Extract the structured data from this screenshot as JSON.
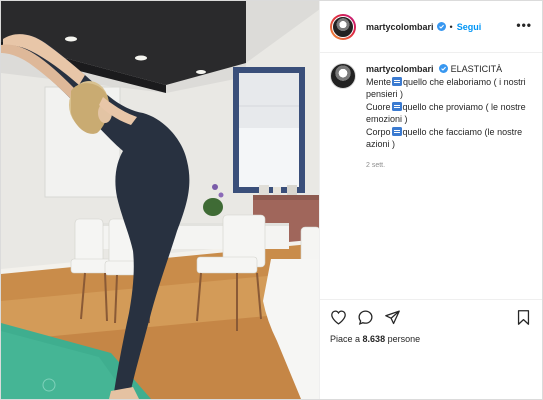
{
  "post": {
    "username": "martycolombari",
    "follow_label": "Segui",
    "separator": "•",
    "more_label": "•••"
  },
  "caption": {
    "username": "martycolombari",
    "title": "ELASTICITÀ",
    "lines": [
      {
        "word": "Mente",
        "rest": "quello che elaboriamo ( i nostri pensieri )"
      },
      {
        "word": "Cuore",
        "rest": "quello che proviamo ( le nostre emozioni )"
      },
      {
        "word": "Corpo",
        "rest": "quello che facciamo (le nostre azioni )"
      }
    ],
    "time": "2 sett."
  },
  "engagement": {
    "likes_prefix": "Piace a",
    "likes_count": "8.638",
    "likes_suffix": "persone"
  },
  "icons": [
    "verified-badge-icon",
    "heart-icon",
    "comment-icon",
    "share-icon",
    "bookmark-icon"
  ],
  "colors": {
    "accent": "#0095f6",
    "verified": "#3897f0",
    "emoji_blue": "#3b7bd1",
    "mat_green": "#3fae8f"
  }
}
